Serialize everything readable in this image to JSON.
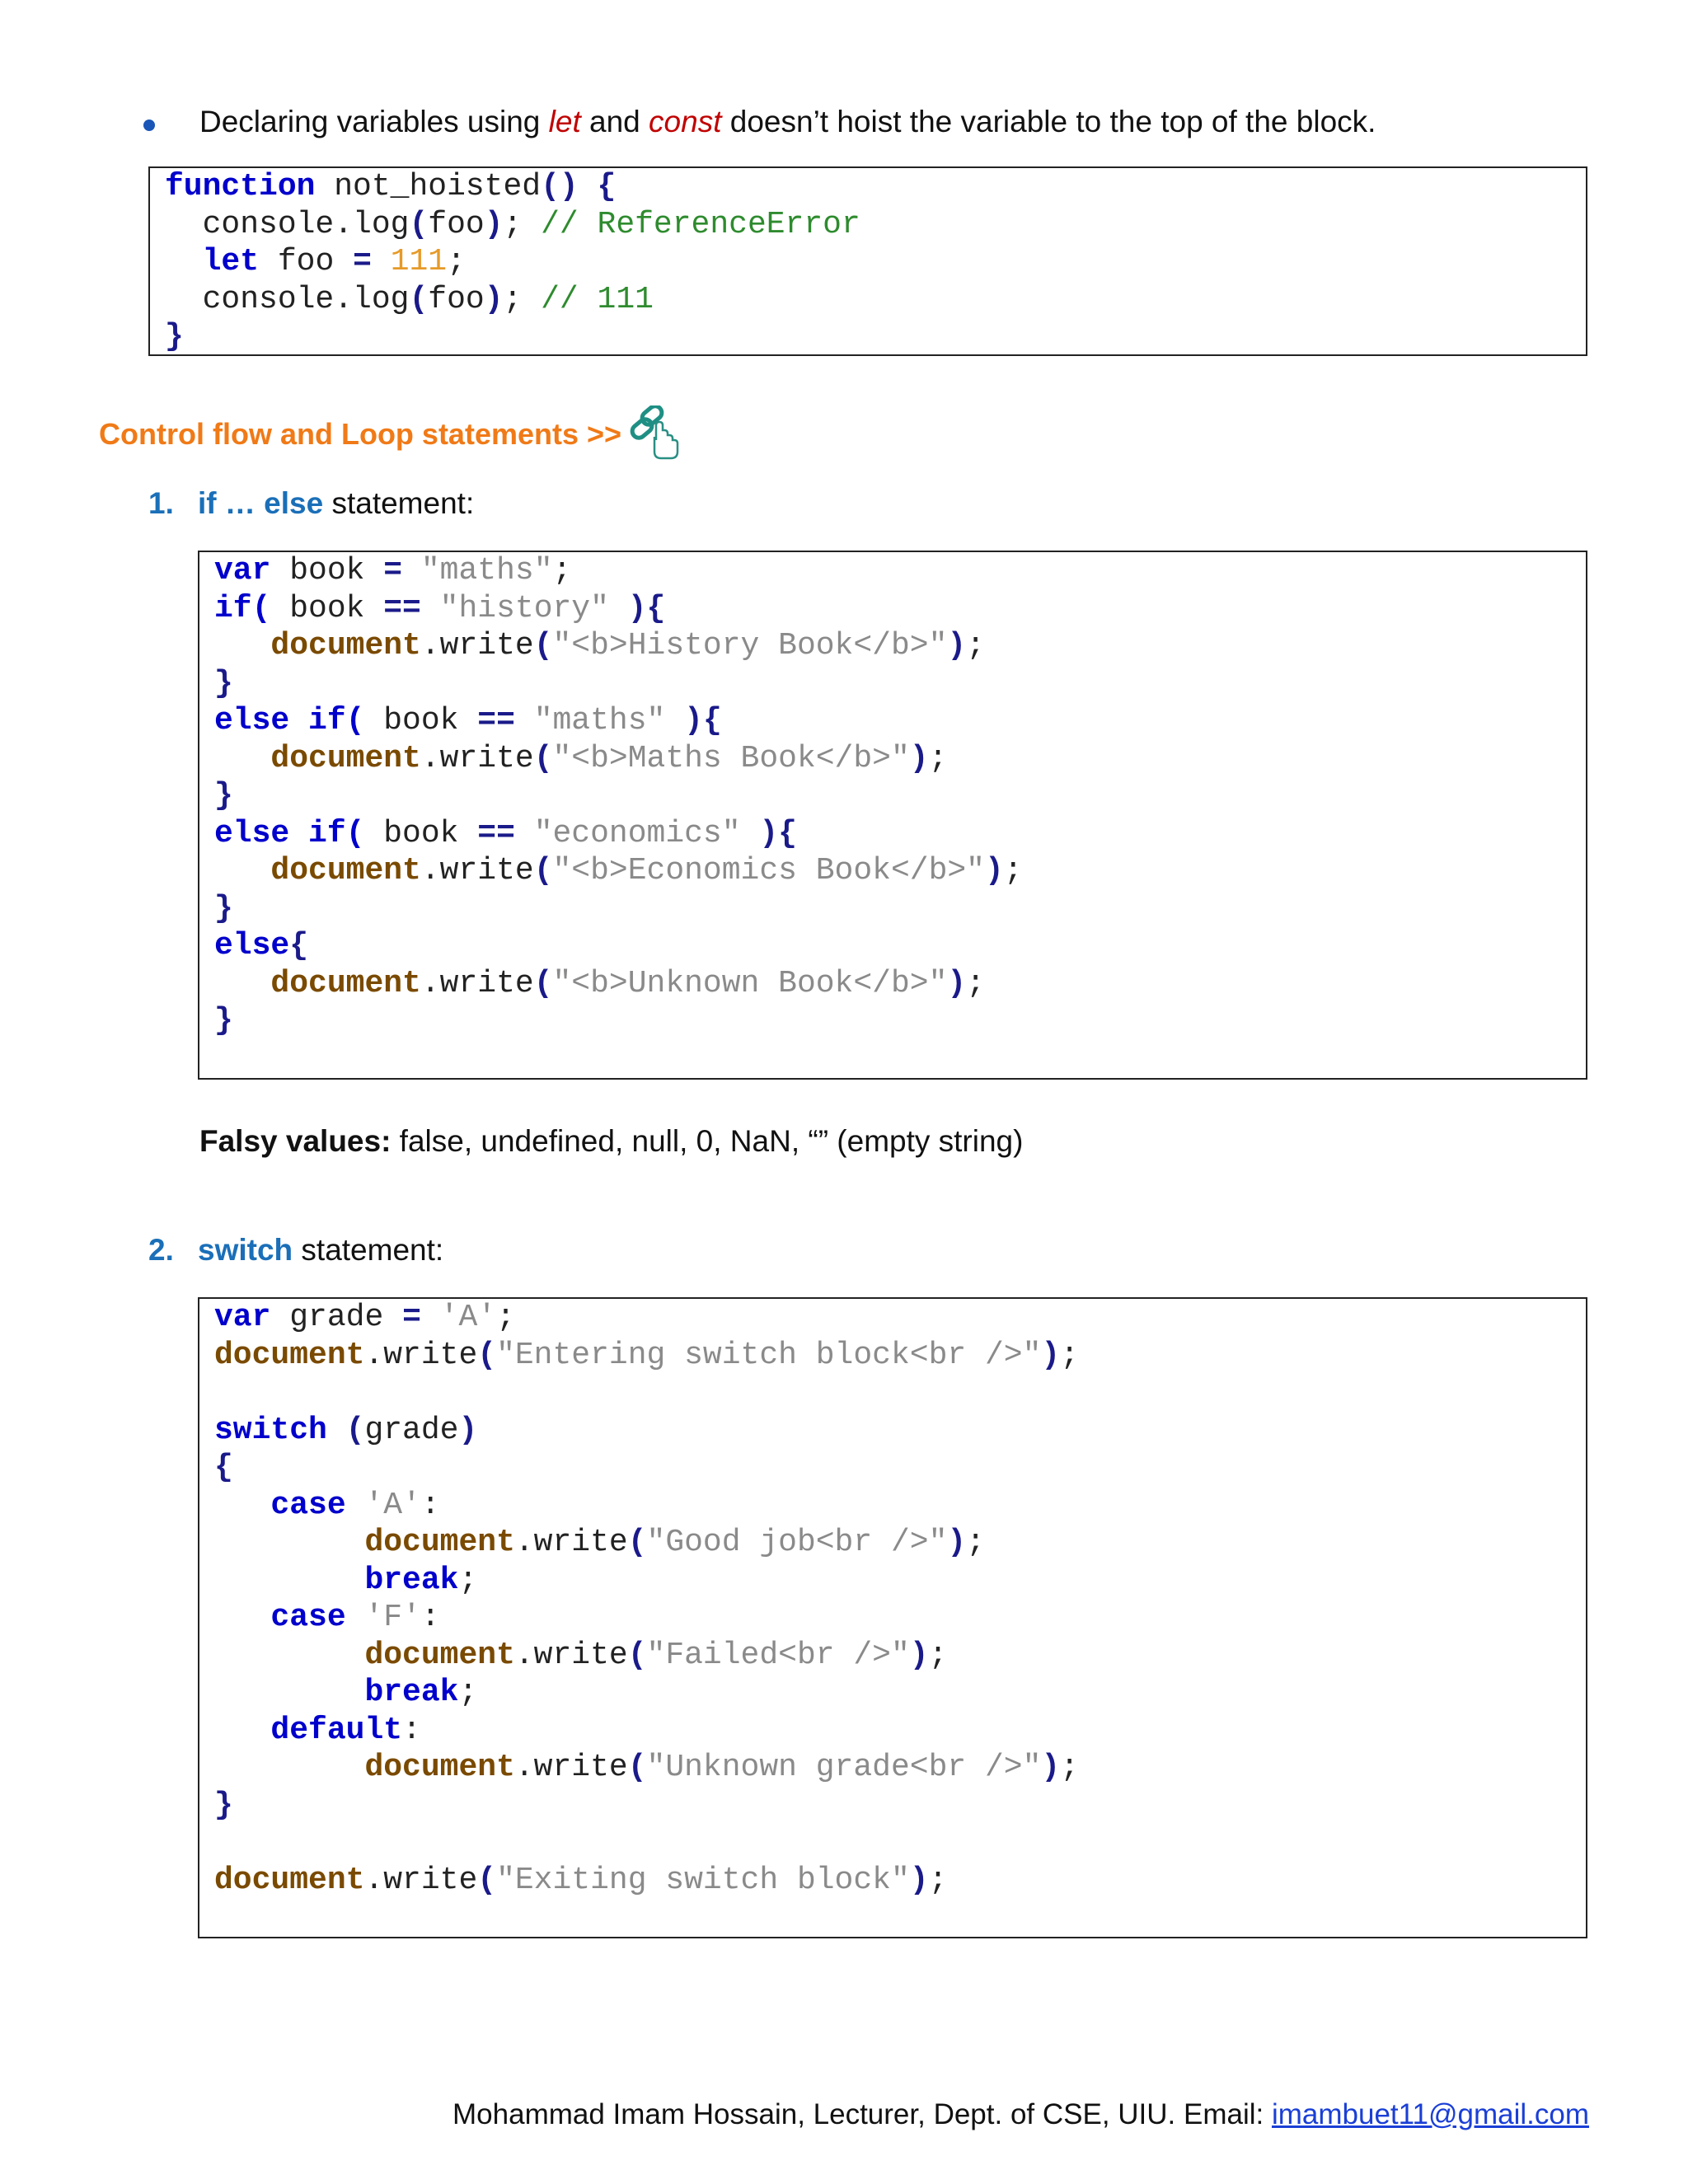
{
  "bullet": {
    "prefix": "Declaring variables using ",
    "kw1": "let",
    "mid": " and ",
    "kw2": "const",
    "suffix": " doesn’t hoist the variable to the top of the block."
  },
  "section_heading": "Control flow and Loop statements >>",
  "item1": {
    "number": "1.",
    "keyword": "if … else",
    "rest": " statement:"
  },
  "falsy": {
    "label": "Falsy values:",
    "text": " false, undefined, null, 0, NaN, “” (empty string)"
  },
  "item2": {
    "number": "2.",
    "keyword": "switch",
    "rest": " statement:"
  },
  "footer": {
    "text": "Mohammad Imam Hossain, Lecturer, Dept. of CSE, UIU. Email: ",
    "email": "imambuet11@gmail.com"
  },
  "code_blocks": [
    {
      "name": "hoist",
      "lines": [
        [
          [
            "k",
            "function"
          ],
          [
            "t",
            " not_hoisted"
          ],
          [
            "p",
            "() {"
          ]
        ],
        [
          [
            "t",
            "  console.log"
          ],
          [
            "p",
            "("
          ],
          [
            "t",
            "foo"
          ],
          [
            "p",
            ")"
          ],
          [
            "t",
            "; "
          ],
          [
            "c",
            "// ReferenceError"
          ]
        ],
        [
          [
            "t",
            "  "
          ],
          [
            "k",
            "let"
          ],
          [
            "t",
            " foo "
          ],
          [
            "p",
            "="
          ],
          [
            "t",
            " "
          ],
          [
            "n",
            "111"
          ],
          [
            "t",
            ";"
          ]
        ],
        [
          [
            "t",
            "  console.log"
          ],
          [
            "p",
            "("
          ],
          [
            "t",
            "foo"
          ],
          [
            "p",
            ")"
          ],
          [
            "t",
            "; "
          ],
          [
            "c",
            "// 111"
          ]
        ],
        [
          [
            "p",
            "}"
          ]
        ]
      ]
    },
    {
      "name": "ifelse",
      "lines": [
        [
          [
            "k",
            "var"
          ],
          [
            "t",
            " book "
          ],
          [
            "p",
            "="
          ],
          [
            "t",
            " "
          ],
          [
            "s",
            "\"maths\""
          ],
          [
            "t",
            ";"
          ]
        ],
        [
          [
            "k",
            "if("
          ],
          [
            "t",
            " book "
          ],
          [
            "p",
            "=="
          ],
          [
            "t",
            " "
          ],
          [
            "s",
            "\"history\""
          ],
          [
            "t",
            " "
          ],
          [
            "p",
            "){"
          ]
        ],
        [
          [
            "t",
            "   "
          ],
          [
            "d",
            "document"
          ],
          [
            "t",
            ".write"
          ],
          [
            "p",
            "("
          ],
          [
            "s",
            "\"<b>History Book</b>\""
          ],
          [
            "p",
            ")"
          ],
          [
            "t",
            ";"
          ]
        ],
        [
          [
            "p",
            "}"
          ]
        ],
        [
          [
            "k",
            "else if("
          ],
          [
            "t",
            " book "
          ],
          [
            "p",
            "=="
          ],
          [
            "t",
            " "
          ],
          [
            "s",
            "\"maths\""
          ],
          [
            "t",
            " "
          ],
          [
            "p",
            "){"
          ]
        ],
        [
          [
            "t",
            "   "
          ],
          [
            "d",
            "document"
          ],
          [
            "t",
            ".write"
          ],
          [
            "p",
            "("
          ],
          [
            "s",
            "\"<b>Maths Book</b>\""
          ],
          [
            "p",
            ")"
          ],
          [
            "t",
            ";"
          ]
        ],
        [
          [
            "p",
            "}"
          ]
        ],
        [
          [
            "k",
            "else if("
          ],
          [
            "t",
            " book "
          ],
          [
            "p",
            "=="
          ],
          [
            "t",
            " "
          ],
          [
            "s",
            "\"economics\""
          ],
          [
            "t",
            " "
          ],
          [
            "p",
            "){"
          ]
        ],
        [
          [
            "t",
            "   "
          ],
          [
            "d",
            "document"
          ],
          [
            "t",
            ".write"
          ],
          [
            "p",
            "("
          ],
          [
            "s",
            "\"<b>Economics Book</b>\""
          ],
          [
            "p",
            ")"
          ],
          [
            "t",
            ";"
          ]
        ],
        [
          [
            "p",
            "}"
          ]
        ],
        [
          [
            "k",
            "else"
          ],
          [
            "p",
            "{"
          ]
        ],
        [
          [
            "t",
            "   "
          ],
          [
            "d",
            "document"
          ],
          [
            "t",
            ".write"
          ],
          [
            "p",
            "("
          ],
          [
            "s",
            "\"<b>Unknown Book</b>\""
          ],
          [
            "p",
            ")"
          ],
          [
            "t",
            ";"
          ]
        ],
        [
          [
            "p",
            "}"
          ]
        ]
      ]
    },
    {
      "name": "switch",
      "lines": [
        [
          [
            "k",
            "var"
          ],
          [
            "t",
            " grade "
          ],
          [
            "p",
            "="
          ],
          [
            "t",
            " "
          ],
          [
            "s",
            "'A'"
          ],
          [
            "t",
            ";"
          ]
        ],
        [
          [
            "d",
            "document"
          ],
          [
            "t",
            ".write"
          ],
          [
            "p",
            "("
          ],
          [
            "s",
            "\"Entering switch block<br />\""
          ],
          [
            "p",
            ")"
          ],
          [
            "t",
            ";"
          ]
        ],
        [
          [
            "t",
            ""
          ]
        ],
        [
          [
            "k",
            "switch"
          ],
          [
            "t",
            " "
          ],
          [
            "p",
            "("
          ],
          [
            "t",
            "grade"
          ],
          [
            "p",
            ")"
          ]
        ],
        [
          [
            "p",
            "{"
          ]
        ],
        [
          [
            "t",
            "   "
          ],
          [
            "k",
            "case"
          ],
          [
            "t",
            " "
          ],
          [
            "s",
            "'A'"
          ],
          [
            "t",
            ":"
          ]
        ],
        [
          [
            "t",
            "        "
          ],
          [
            "d",
            "document"
          ],
          [
            "t",
            ".write"
          ],
          [
            "p",
            "("
          ],
          [
            "s",
            "\"Good job<br />\""
          ],
          [
            "p",
            ")"
          ],
          [
            "t",
            ";"
          ]
        ],
        [
          [
            "t",
            "        "
          ],
          [
            "k",
            "break"
          ],
          [
            "t",
            ";"
          ]
        ],
        [
          [
            "t",
            "   "
          ],
          [
            "k",
            "case"
          ],
          [
            "t",
            " "
          ],
          [
            "s",
            "'F'"
          ],
          [
            "t",
            ":"
          ]
        ],
        [
          [
            "t",
            "        "
          ],
          [
            "d",
            "document"
          ],
          [
            "t",
            ".write"
          ],
          [
            "p",
            "("
          ],
          [
            "s",
            "\"Failed<br />\""
          ],
          [
            "p",
            ")"
          ],
          [
            "t",
            ";"
          ]
        ],
        [
          [
            "t",
            "        "
          ],
          [
            "k",
            "break"
          ],
          [
            "t",
            ";"
          ]
        ],
        [
          [
            "t",
            "   "
          ],
          [
            "k",
            "default"
          ],
          [
            "t",
            ":"
          ]
        ],
        [
          [
            "t",
            "        "
          ],
          [
            "d",
            "document"
          ],
          [
            "t",
            ".write"
          ],
          [
            "p",
            "("
          ],
          [
            "s",
            "\"Unknown grade<br />\""
          ],
          [
            "p",
            ")"
          ],
          [
            "t",
            ";"
          ]
        ],
        [
          [
            "p",
            "}"
          ]
        ],
        [
          [
            "t",
            ""
          ]
        ],
        [
          [
            "d",
            "document"
          ],
          [
            "t",
            ".write"
          ],
          [
            "p",
            "("
          ],
          [
            "s",
            "\"Exiting switch block\""
          ],
          [
            "p",
            ")"
          ],
          [
            "t",
            ";"
          ]
        ]
      ]
    }
  ]
}
